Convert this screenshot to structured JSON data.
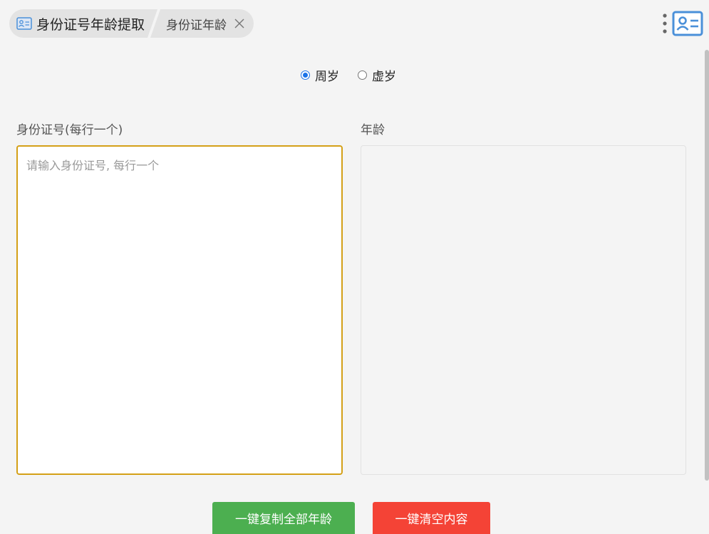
{
  "tabs": {
    "main_title": "身份证号年龄提取",
    "second_title": "身份证年龄"
  },
  "radio": {
    "options": [
      {
        "label": "周岁",
        "checked": true
      },
      {
        "label": "虚岁",
        "checked": false
      }
    ]
  },
  "input": {
    "label": "身份证号(每行一个)",
    "placeholder": "请输入身份证号, 每行一个",
    "value": ""
  },
  "output": {
    "label": "年龄",
    "value": ""
  },
  "buttons": {
    "copy_label": "一键复制全部年龄",
    "clear_label": "一键清空内容"
  },
  "colors": {
    "accent_blue": "#1a73e8",
    "input_border": "#d4a017",
    "copy_button": "#4caf50",
    "clear_button": "#f44336",
    "logo_blue": "#4a90d9"
  },
  "icons": {
    "tab_icon": "id-card-icon",
    "close_icon": "close-icon",
    "more_icon": "more-vertical-icon",
    "logo_icon": "id-card-icon"
  }
}
